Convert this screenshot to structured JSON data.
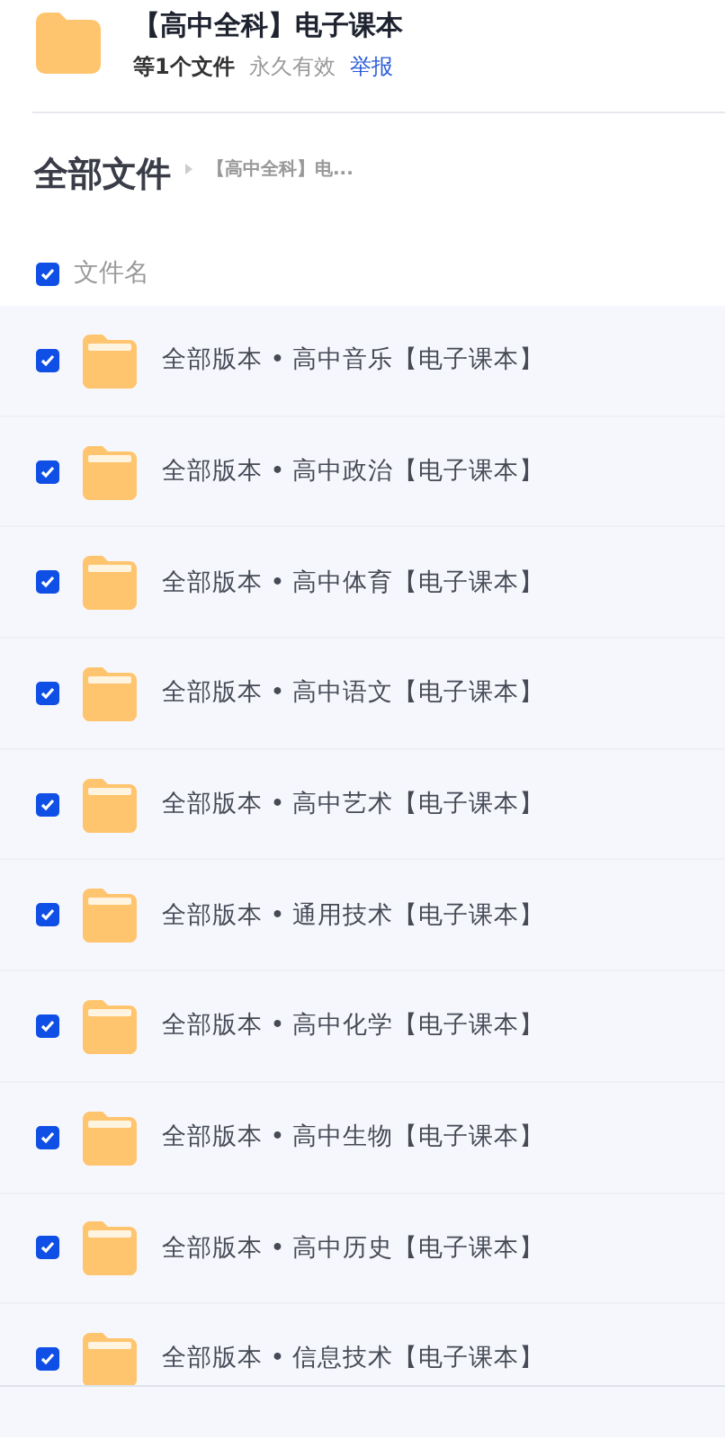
{
  "share": {
    "title": "【高中全科】电子课本",
    "file_count": "等1个文件",
    "validity": "永久有效",
    "report_link": "举报"
  },
  "breadcrumb": {
    "root": "全部文件",
    "current": "【高中全科】电..."
  },
  "header": {
    "label": "文件名",
    "checked": true
  },
  "files": [
    {
      "name": "全部版本 • 高中音乐【电子课本】",
      "checked": true
    },
    {
      "name": "全部版本 • 高中政治【电子课本】",
      "checked": true
    },
    {
      "name": "全部版本 • 高中体育【电子课本】",
      "checked": true
    },
    {
      "name": "全部版本 • 高中语文【电子课本】",
      "checked": true
    },
    {
      "name": "全部版本 • 高中艺术【电子课本】",
      "checked": true
    },
    {
      "name": "全部版本 • 通用技术【电子课本】",
      "checked": true
    },
    {
      "name": "全部版本 • 高中化学【电子课本】",
      "checked": true
    },
    {
      "name": "全部版本 • 高中生物【电子课本】",
      "checked": true
    },
    {
      "name": "全部版本 • 高中历史【电子课本】",
      "checked": true
    },
    {
      "name": "全部版本 • 信息技术【电子课本】",
      "checked": true
    }
  ]
}
